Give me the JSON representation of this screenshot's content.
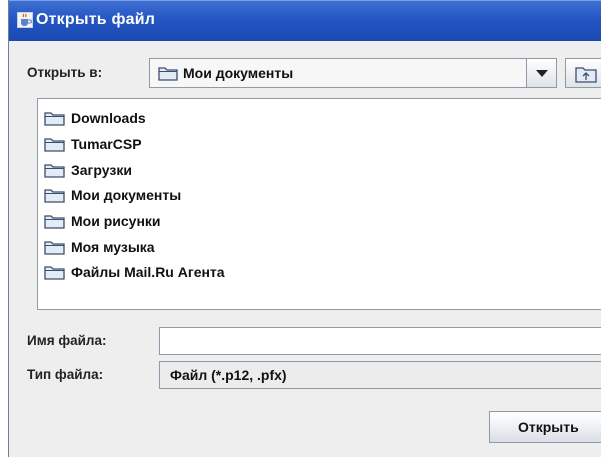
{
  "window": {
    "title": "Открыть файл",
    "icon": "java-cup-icon"
  },
  "lookin": {
    "label": "Открыть в:",
    "selected": "Мои документы",
    "icon": "folder-icon",
    "up_icon": "folder-up-icon"
  },
  "files": [
    {
      "name": "Downloads",
      "icon": "folder-icon"
    },
    {
      "name": "TumarCSP",
      "icon": "folder-icon"
    },
    {
      "name": "Загрузки",
      "icon": "folder-icon"
    },
    {
      "name": "Мои документы",
      "icon": "folder-icon"
    },
    {
      "name": "Мои рисунки",
      "icon": "folder-icon"
    },
    {
      "name": "Моя музыка",
      "icon": "folder-icon"
    },
    {
      "name": "Файлы Mail.Ru Агента",
      "icon": "folder-icon"
    }
  ],
  "filename": {
    "label": "Имя файла:",
    "value": ""
  },
  "filetype": {
    "label": "Тип файла:",
    "selected": "Файл (*.p12, .pfx)"
  },
  "buttons": {
    "open": "Открыть"
  },
  "colors": {
    "titlebar": "#2456c4",
    "dialog_bg": "#eeeeee",
    "folder_fill": "#e3ebf7",
    "folder_stroke": "#3b4e6b"
  }
}
